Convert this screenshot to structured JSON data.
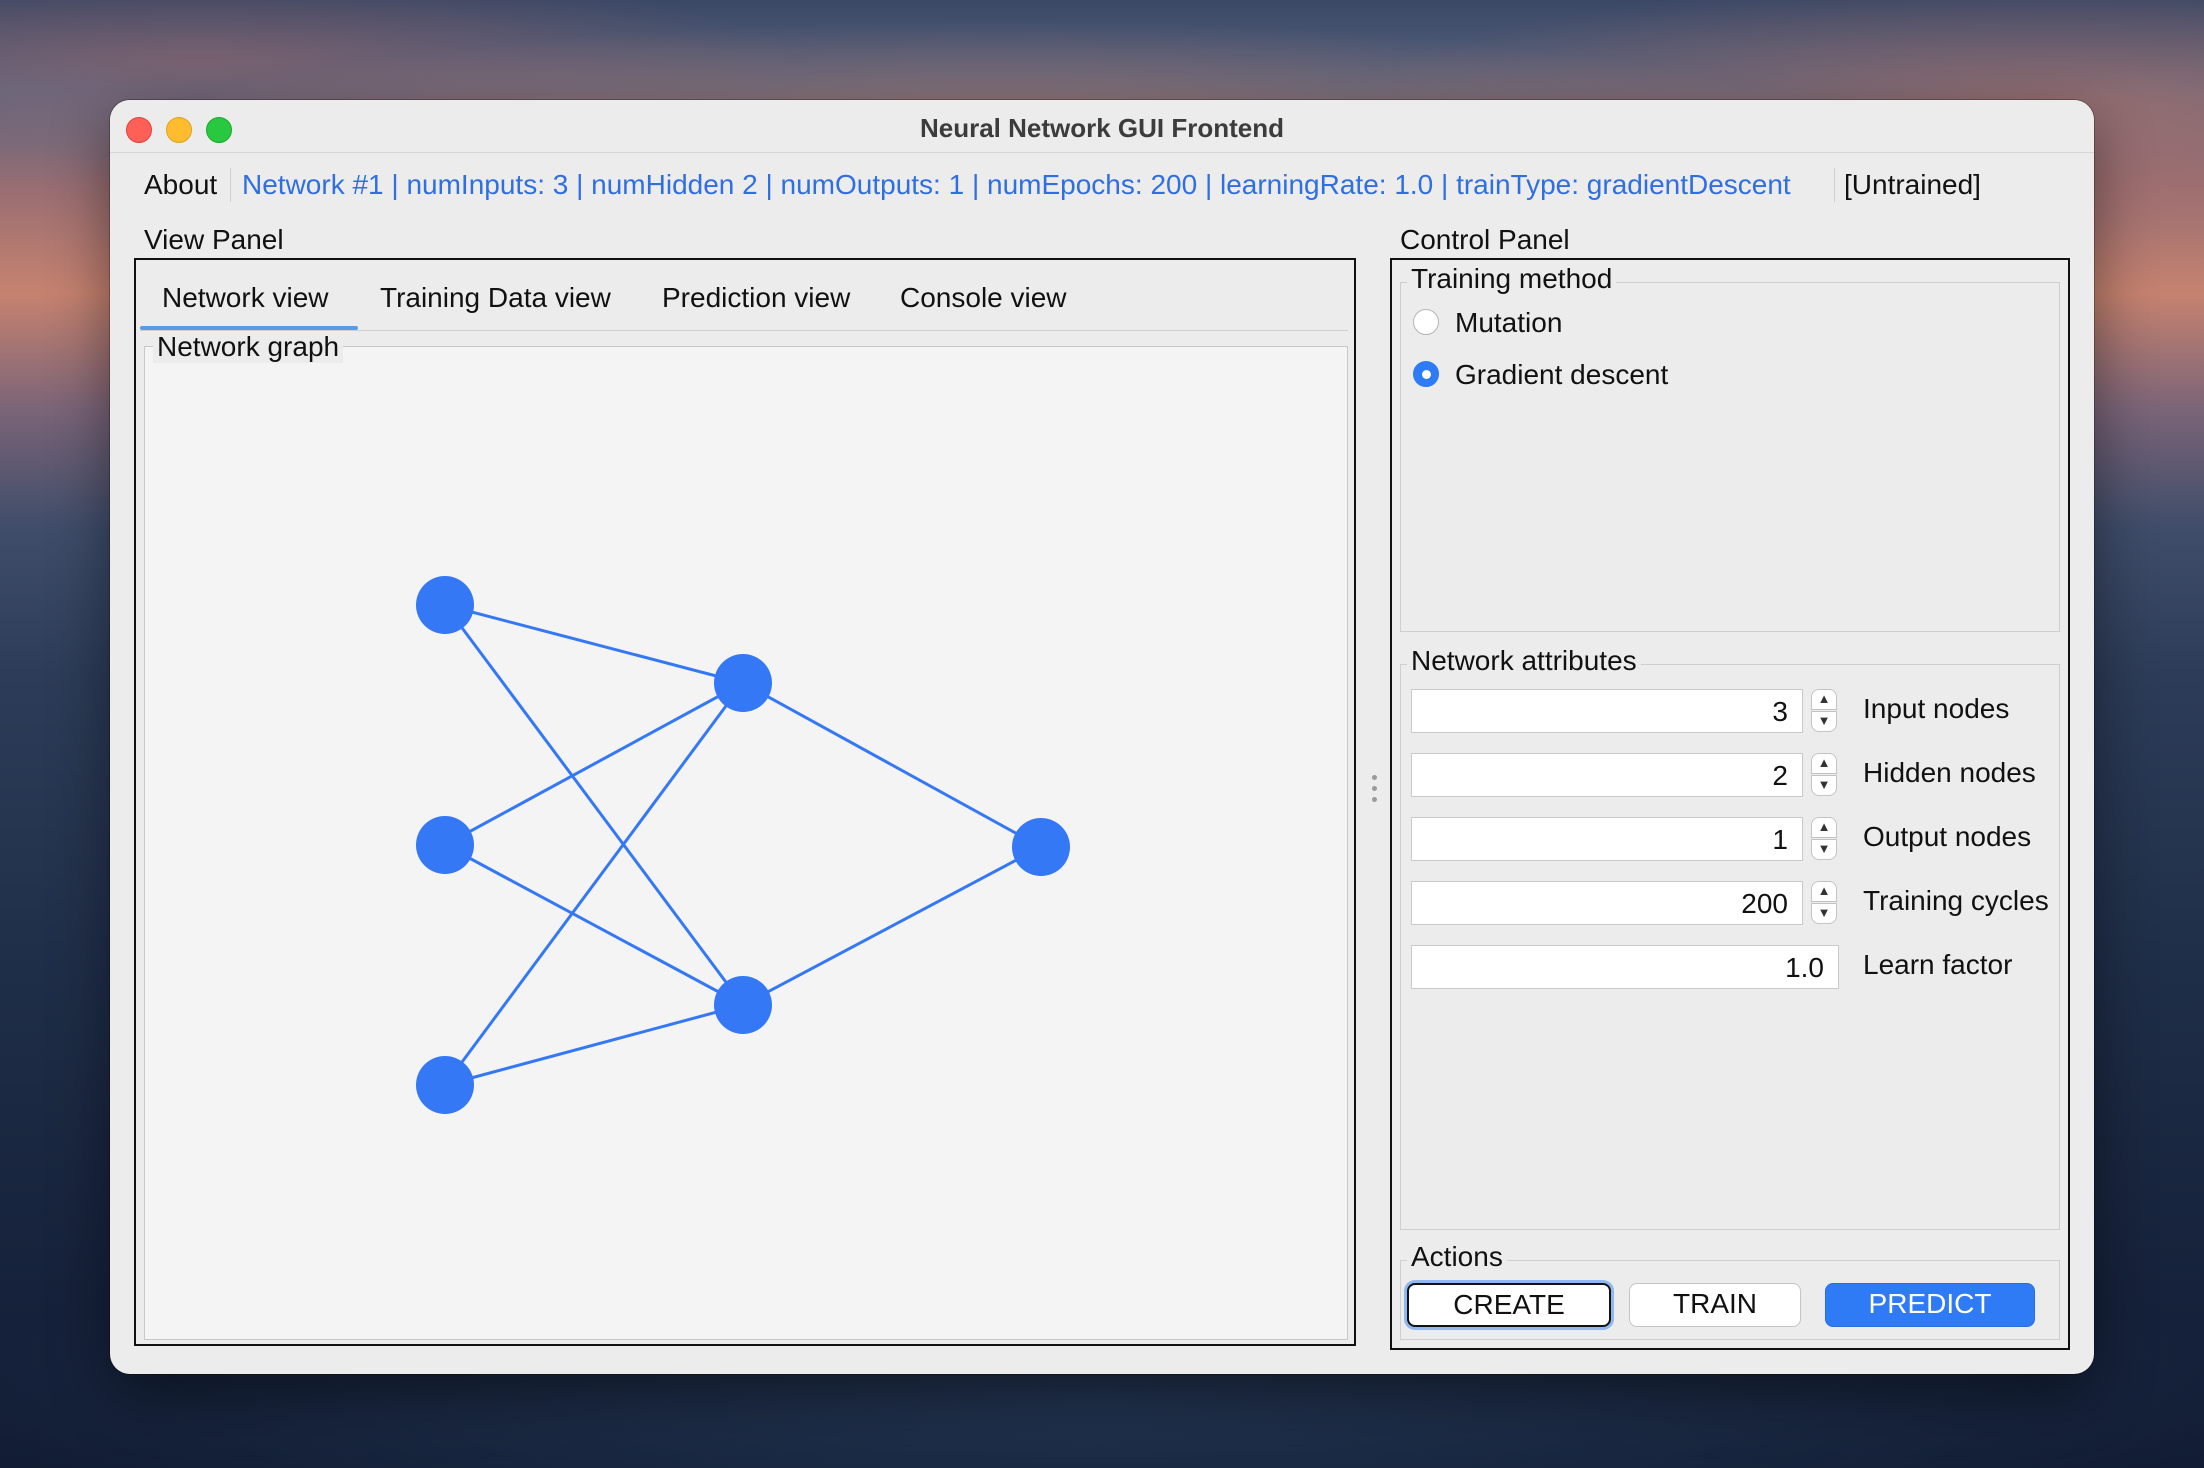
{
  "window": {
    "title": "Neural Network GUI Frontend"
  },
  "menubar": {
    "about": "About",
    "network_info": "Network #1 | numInputs: 3 | numHidden 2 | numOutputs: 1 | numEpochs: 200 | learningRate: 1.0 | trainType: gradientDescent",
    "status": "[Untrained]"
  },
  "view_panel": {
    "title": "View Panel",
    "tabs": [
      "Network view",
      "Training Data view",
      "Prediction view",
      "Console view"
    ],
    "active_tab": "Network view",
    "graph_title": "Network graph"
  },
  "network": {
    "layers": [
      3,
      2,
      1
    ],
    "node_color": "#3478f6",
    "edge_color": "#3478f6"
  },
  "control_panel": {
    "title": "Control Panel",
    "training_method": {
      "title": "Training method",
      "options": [
        "Mutation",
        "Gradient descent"
      ],
      "selected": "Gradient descent"
    },
    "network_attributes": {
      "title": "Network attributes",
      "fields": [
        {
          "label": "Input nodes",
          "value": "3",
          "spinner": true
        },
        {
          "label": "Hidden nodes",
          "value": "2",
          "spinner": true
        },
        {
          "label": "Output nodes",
          "value": "1",
          "spinner": true
        },
        {
          "label": "Training cycles",
          "value": "200",
          "spinner": true
        },
        {
          "label": "Learn factor",
          "value": "1.0",
          "spinner": false
        }
      ]
    },
    "actions": {
      "title": "Actions",
      "create": "CREATE",
      "train": "TRAIN",
      "predict": "PREDICT"
    }
  },
  "colors": {
    "accent": "#2f7bf5",
    "link": "#2f6fe0"
  }
}
